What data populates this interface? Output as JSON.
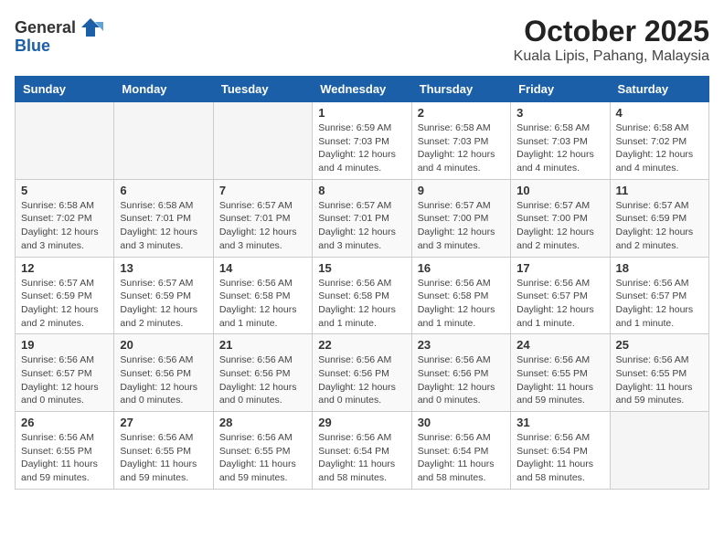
{
  "header": {
    "logo_general": "General",
    "logo_blue": "Blue",
    "title": "October 2025",
    "subtitle": "Kuala Lipis, Pahang, Malaysia"
  },
  "weekdays": [
    "Sunday",
    "Monday",
    "Tuesday",
    "Wednesday",
    "Thursday",
    "Friday",
    "Saturday"
  ],
  "weeks": [
    [
      {
        "day": "",
        "sunrise": "",
        "sunset": "",
        "daylight": ""
      },
      {
        "day": "",
        "sunrise": "",
        "sunset": "",
        "daylight": ""
      },
      {
        "day": "",
        "sunrise": "",
        "sunset": "",
        "daylight": ""
      },
      {
        "day": "1",
        "sunrise": "Sunrise: 6:59 AM",
        "sunset": "Sunset: 7:03 PM",
        "daylight": "Daylight: 12 hours and 4 minutes."
      },
      {
        "day": "2",
        "sunrise": "Sunrise: 6:58 AM",
        "sunset": "Sunset: 7:03 PM",
        "daylight": "Daylight: 12 hours and 4 minutes."
      },
      {
        "day": "3",
        "sunrise": "Sunrise: 6:58 AM",
        "sunset": "Sunset: 7:03 PM",
        "daylight": "Daylight: 12 hours and 4 minutes."
      },
      {
        "day": "4",
        "sunrise": "Sunrise: 6:58 AM",
        "sunset": "Sunset: 7:02 PM",
        "daylight": "Daylight: 12 hours and 4 minutes."
      }
    ],
    [
      {
        "day": "5",
        "sunrise": "Sunrise: 6:58 AM",
        "sunset": "Sunset: 7:02 PM",
        "daylight": "Daylight: 12 hours and 3 minutes."
      },
      {
        "day": "6",
        "sunrise": "Sunrise: 6:58 AM",
        "sunset": "Sunset: 7:01 PM",
        "daylight": "Daylight: 12 hours and 3 minutes."
      },
      {
        "day": "7",
        "sunrise": "Sunrise: 6:57 AM",
        "sunset": "Sunset: 7:01 PM",
        "daylight": "Daylight: 12 hours and 3 minutes."
      },
      {
        "day": "8",
        "sunrise": "Sunrise: 6:57 AM",
        "sunset": "Sunset: 7:01 PM",
        "daylight": "Daylight: 12 hours and 3 minutes."
      },
      {
        "day": "9",
        "sunrise": "Sunrise: 6:57 AM",
        "sunset": "Sunset: 7:00 PM",
        "daylight": "Daylight: 12 hours and 3 minutes."
      },
      {
        "day": "10",
        "sunrise": "Sunrise: 6:57 AM",
        "sunset": "Sunset: 7:00 PM",
        "daylight": "Daylight: 12 hours and 2 minutes."
      },
      {
        "day": "11",
        "sunrise": "Sunrise: 6:57 AM",
        "sunset": "Sunset: 6:59 PM",
        "daylight": "Daylight: 12 hours and 2 minutes."
      }
    ],
    [
      {
        "day": "12",
        "sunrise": "Sunrise: 6:57 AM",
        "sunset": "Sunset: 6:59 PM",
        "daylight": "Daylight: 12 hours and 2 minutes."
      },
      {
        "day": "13",
        "sunrise": "Sunrise: 6:57 AM",
        "sunset": "Sunset: 6:59 PM",
        "daylight": "Daylight: 12 hours and 2 minutes."
      },
      {
        "day": "14",
        "sunrise": "Sunrise: 6:56 AM",
        "sunset": "Sunset: 6:58 PM",
        "daylight": "Daylight: 12 hours and 1 minute."
      },
      {
        "day": "15",
        "sunrise": "Sunrise: 6:56 AM",
        "sunset": "Sunset: 6:58 PM",
        "daylight": "Daylight: 12 hours and 1 minute."
      },
      {
        "day": "16",
        "sunrise": "Sunrise: 6:56 AM",
        "sunset": "Sunset: 6:58 PM",
        "daylight": "Daylight: 12 hours and 1 minute."
      },
      {
        "day": "17",
        "sunrise": "Sunrise: 6:56 AM",
        "sunset": "Sunset: 6:57 PM",
        "daylight": "Daylight: 12 hours and 1 minute."
      },
      {
        "day": "18",
        "sunrise": "Sunrise: 6:56 AM",
        "sunset": "Sunset: 6:57 PM",
        "daylight": "Daylight: 12 hours and 1 minute."
      }
    ],
    [
      {
        "day": "19",
        "sunrise": "Sunrise: 6:56 AM",
        "sunset": "Sunset: 6:57 PM",
        "daylight": "Daylight: 12 hours and 0 minutes."
      },
      {
        "day": "20",
        "sunrise": "Sunrise: 6:56 AM",
        "sunset": "Sunset: 6:56 PM",
        "daylight": "Daylight: 12 hours and 0 minutes."
      },
      {
        "day": "21",
        "sunrise": "Sunrise: 6:56 AM",
        "sunset": "Sunset: 6:56 PM",
        "daylight": "Daylight: 12 hours and 0 minutes."
      },
      {
        "day": "22",
        "sunrise": "Sunrise: 6:56 AM",
        "sunset": "Sunset: 6:56 PM",
        "daylight": "Daylight: 12 hours and 0 minutes."
      },
      {
        "day": "23",
        "sunrise": "Sunrise: 6:56 AM",
        "sunset": "Sunset: 6:56 PM",
        "daylight": "Daylight: 12 hours and 0 minutes."
      },
      {
        "day": "24",
        "sunrise": "Sunrise: 6:56 AM",
        "sunset": "Sunset: 6:55 PM",
        "daylight": "Daylight: 11 hours and 59 minutes."
      },
      {
        "day": "25",
        "sunrise": "Sunrise: 6:56 AM",
        "sunset": "Sunset: 6:55 PM",
        "daylight": "Daylight: 11 hours and 59 minutes."
      }
    ],
    [
      {
        "day": "26",
        "sunrise": "Sunrise: 6:56 AM",
        "sunset": "Sunset: 6:55 PM",
        "daylight": "Daylight: 11 hours and 59 minutes."
      },
      {
        "day": "27",
        "sunrise": "Sunrise: 6:56 AM",
        "sunset": "Sunset: 6:55 PM",
        "daylight": "Daylight: 11 hours and 59 minutes."
      },
      {
        "day": "28",
        "sunrise": "Sunrise: 6:56 AM",
        "sunset": "Sunset: 6:55 PM",
        "daylight": "Daylight: 11 hours and 59 minutes."
      },
      {
        "day": "29",
        "sunrise": "Sunrise: 6:56 AM",
        "sunset": "Sunset: 6:54 PM",
        "daylight": "Daylight: 11 hours and 58 minutes."
      },
      {
        "day": "30",
        "sunrise": "Sunrise: 6:56 AM",
        "sunset": "Sunset: 6:54 PM",
        "daylight": "Daylight: 11 hours and 58 minutes."
      },
      {
        "day": "31",
        "sunrise": "Sunrise: 6:56 AM",
        "sunset": "Sunset: 6:54 PM",
        "daylight": "Daylight: 11 hours and 58 minutes."
      },
      {
        "day": "",
        "sunrise": "",
        "sunset": "",
        "daylight": ""
      }
    ]
  ]
}
